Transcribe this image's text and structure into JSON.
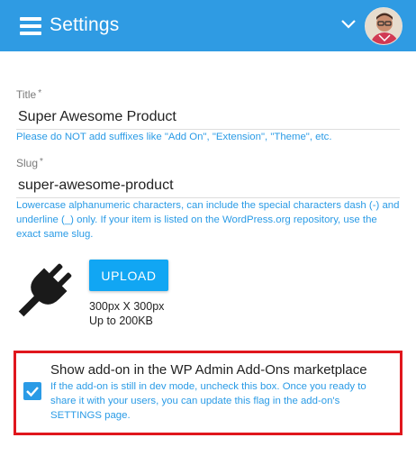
{
  "header": {
    "title": "Settings",
    "menu_icon": "hamburger-menu-icon",
    "dropdown_icon": "chevron-down-icon",
    "background_color": "#2f9be3"
  },
  "form": {
    "title_field": {
      "label": "Title",
      "required_mark": "*",
      "value": "Super Awesome Product",
      "hint": "Please do NOT add suffixes like \"Add On\", \"Extension\", \"Theme\", etc."
    },
    "slug_field": {
      "label": "Slug",
      "required_mark": "*",
      "value": "super-awesome-product",
      "hint": "Lowercase alphanumeric characters, can include the special characters dash (-) and underline (_) only. If your item is listed on the WordPress.org repository, use the exact same slug."
    },
    "icon_upload": {
      "icon": "plug-icon",
      "button_label": "UPLOAD",
      "dimensions": "300px X 300px",
      "max_size": "Up to 200KB"
    },
    "marketplace_option": {
      "checked": true,
      "title": "Show add-on in the WP Admin Add-Ons marketplace",
      "hint": "If the add-on is still in dev mode, uncheck this box. Once you ready to share it with your users, you can update this flag in the add-on's SETTINGS page.",
      "highlight_color": "#e0161d"
    }
  },
  "colors": {
    "accent": "#2a9be6",
    "button": "#11a6f3"
  }
}
